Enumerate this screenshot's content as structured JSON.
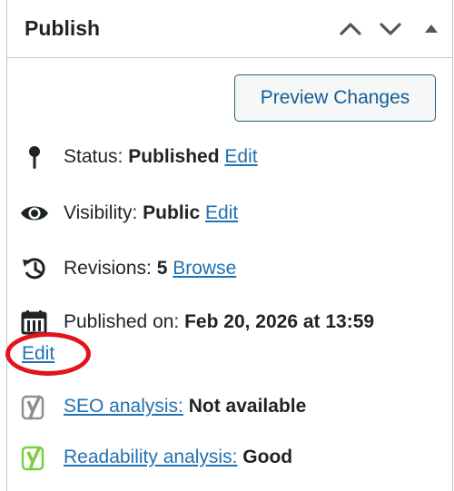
{
  "header": {
    "title": "Publish"
  },
  "actions": {
    "preview_label": "Preview Changes"
  },
  "status": {
    "label": "Status:",
    "value": "Published",
    "link": "Edit"
  },
  "visibility": {
    "label": "Visibility:",
    "value": "Public",
    "link": "Edit"
  },
  "revisions": {
    "label": "Revisions:",
    "value": "5",
    "link": "Browse"
  },
  "published": {
    "label": "Published on:",
    "value": "Feb 20, 2026 at 13:59",
    "link": "Edit"
  },
  "seo": {
    "link": "SEO analysis:",
    "value": "Not available"
  },
  "readability": {
    "link": "Readability analysis:",
    "value": "Good"
  },
  "icons": {
    "move_up": "chevron-up-icon",
    "move_down": "chevron-down-icon",
    "toggle": "triangle-up-icon",
    "status": "pin-icon",
    "visibility": "eye-icon",
    "revisions": "history-icon",
    "published": "calendar-icon",
    "seo": "yoast-gray-icon",
    "readability": "yoast-green-icon"
  },
  "colors": {
    "link": "#2271b1",
    "annotation": "#e3131b",
    "yoast_good": "#7ad03a",
    "yoast_na": "#8c8f94"
  }
}
